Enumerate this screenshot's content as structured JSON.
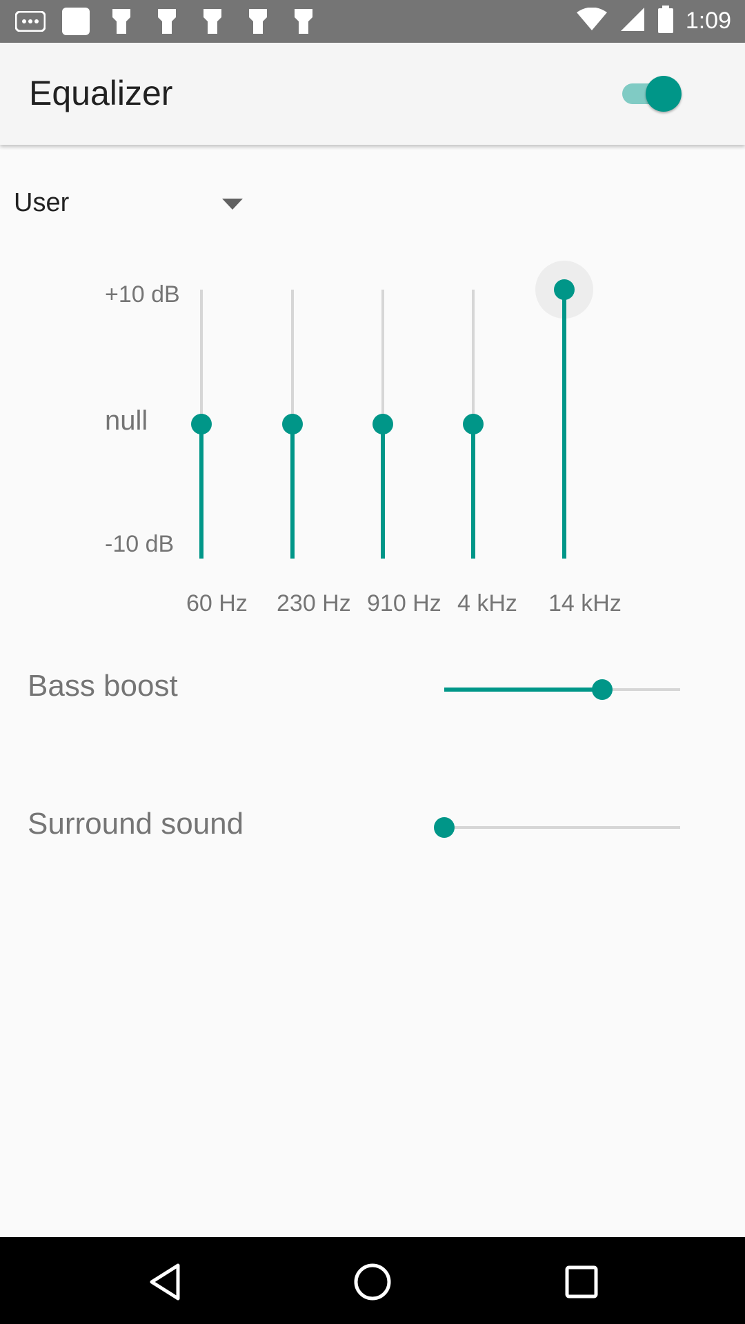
{
  "status_bar": {
    "time": "1:09",
    "icons": [
      "more-icon",
      "square-notification-icon",
      "notification-icon",
      "notification-icon",
      "notification-icon",
      "notification-icon",
      "notification-icon",
      "wifi-icon",
      "signal-icon",
      "battery-icon"
    ]
  },
  "app_bar": {
    "title": "Equalizer",
    "enabled": true
  },
  "preset": {
    "selected": "User"
  },
  "equalizer": {
    "db_labels": {
      "max": "+10 dB",
      "mid": "null",
      "min": "-10 dB"
    },
    "range_db": [
      -10,
      10
    ],
    "bands": [
      {
        "label": "60 Hz",
        "value_db": 0
      },
      {
        "label": "230 Hz",
        "value_db": 0
      },
      {
        "label": "910 Hz",
        "value_db": 0
      },
      {
        "label": "4 kHz",
        "value_db": 0
      },
      {
        "label": "14 kHz",
        "value_db": 10,
        "focused": true
      }
    ]
  },
  "bass_boost": {
    "label": "Bass boost",
    "value_fraction": 0.67
  },
  "surround_sound": {
    "label": "Surround sound",
    "value_fraction": 0.0
  },
  "colors": {
    "accent": "#009688",
    "accent_light": "#80cbc4",
    "inactive_track": "#d6d6d6"
  },
  "nav_bar": {
    "buttons": [
      "back-icon",
      "home-icon",
      "recents-icon"
    ]
  }
}
